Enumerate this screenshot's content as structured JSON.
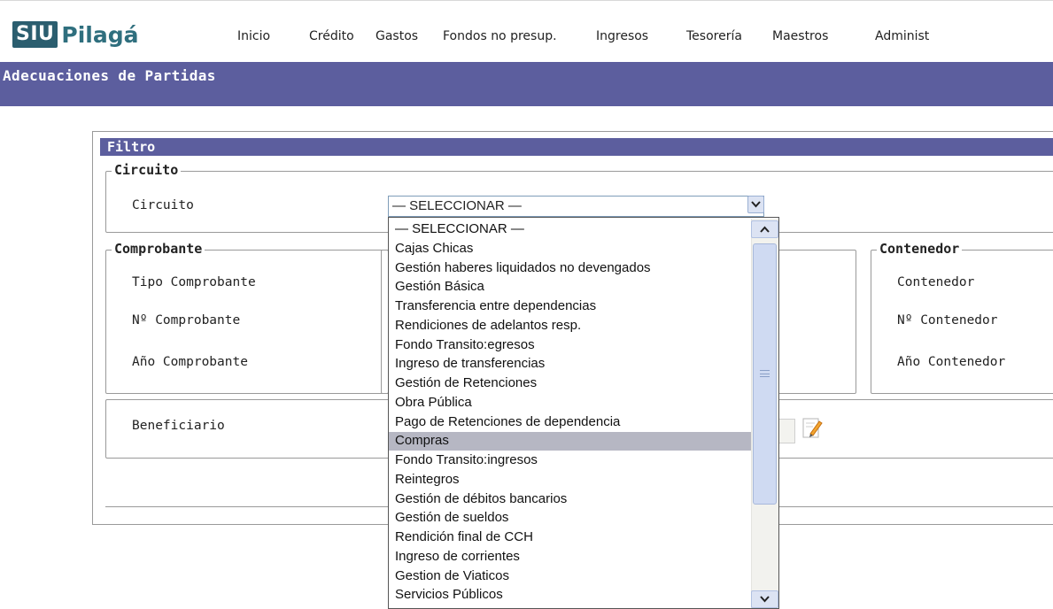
{
  "app": {
    "logo_badge": "SIU",
    "logo_name": "Pilagá"
  },
  "menu": [
    "Inicio",
    "Crédito",
    "Gastos",
    "Fondos no presup.",
    "Ingresos",
    "Tesorería",
    "Maestros",
    "Administ"
  ],
  "page_title": "Adecuaciones de Partidas",
  "filter": {
    "header": "Filtro",
    "circuito_section": {
      "legend": "Circuito",
      "label": "Circuito",
      "selected_value": "— SELECCIONAR —"
    },
    "comprobante_section": {
      "legend": "Comprobante",
      "fields": [
        "Tipo Comprobante",
        "Nº Comprobante",
        "Año Comprobante"
      ]
    },
    "contenedor_section": {
      "legend": "Contenedor",
      "fields": [
        "Contenedor",
        "Nº Contenedor",
        "Año Contenedor"
      ]
    },
    "beneficiario_label": "Beneficiario"
  },
  "dropdown_options": [
    "— SELECCIONAR —",
    "Cajas Chicas",
    "Gestión haberes liquidados no devengados",
    "Gestión Básica",
    "Transferencia entre dependencias",
    "Rendiciones de adelantos resp.",
    "Fondo Transito:egresos",
    "Ingreso de transferencias",
    "Gestión de Retenciones",
    "Obra Pública",
    "Pago de Retenciones de dependencia",
    "Compras",
    "Fondo Transito:ingresos",
    "Reintegros",
    "Gestión de débitos bancarios",
    "Gestión de sueldos",
    "Rendición final de CCH",
    "Ingreso de corrientes",
    "Gestion de Viaticos",
    "Servicios Públicos"
  ],
  "highlighted_option": "Compras",
  "colors": {
    "header_bar": "#5c5e9e",
    "logo_badge": "#2b5e6f",
    "logo_text": "#2f6f7e",
    "highlight": "#b6b7c3"
  }
}
